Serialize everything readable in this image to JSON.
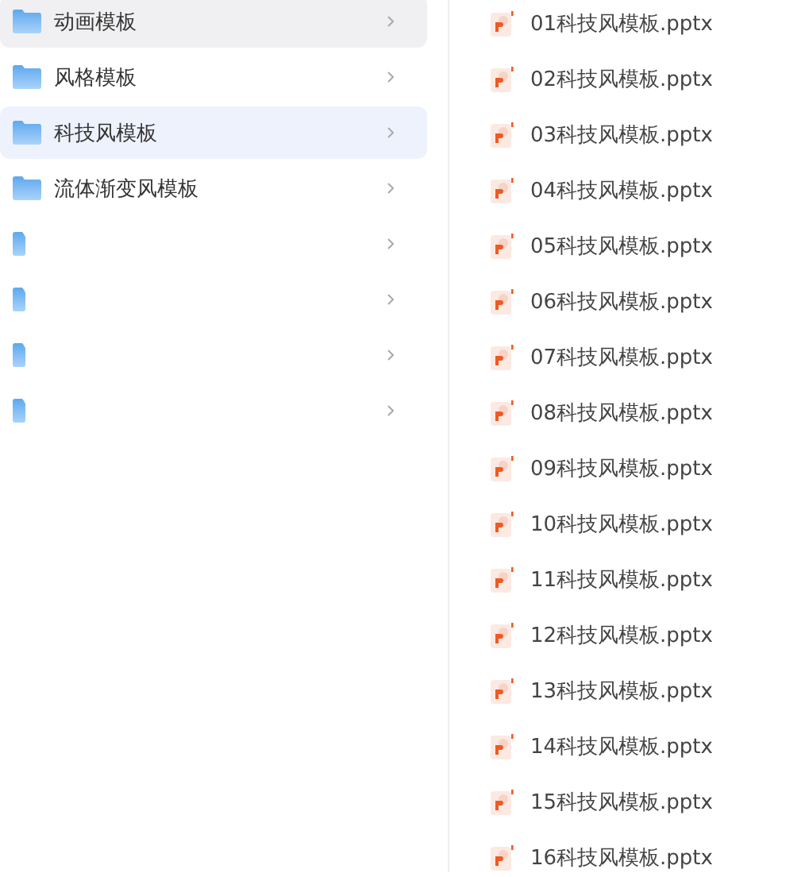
{
  "folders": [
    {
      "name": "动画模板",
      "selected": false,
      "hovered": true
    },
    {
      "name": "风格模板",
      "selected": false,
      "hovered": false
    },
    {
      "name": "科技风模板",
      "selected": true,
      "hovered": false
    },
    {
      "name": "流体渐变风模板",
      "selected": false,
      "hovered": false
    },
    {
      "selected": false,
      "hovered": false
    },
    {
      "selected": false,
      "hovered": false
    },
    {
      "selected": false,
      "hovered": false
    },
    {
      "selected": false,
      "hovered": false
    }
  ],
  "files": [
    {
      "name": "01科技风模板.pptx"
    },
    {
      "name": "02科技风模板.pptx"
    },
    {
      "name": "03科技风模板.pptx"
    },
    {
      "name": "04科技风模板.pptx"
    },
    {
      "name": "05科技风模板.pptx"
    },
    {
      "name": "06科技风模板.pptx"
    },
    {
      "name": "07科技风模板.pptx"
    },
    {
      "name": "08科技风模板.pptx"
    },
    {
      "name": "09科技风模板.pptx"
    },
    {
      "name": "10科技风模板.pptx"
    },
    {
      "name": "11科技风模板.pptx"
    },
    {
      "name": "12科技风模板.pptx"
    },
    {
      "name": "13科技风模板.pptx"
    },
    {
      "name": "14科技风模板.pptx"
    },
    {
      "name": "15科技风模板.pptx"
    },
    {
      "name": "16科技风模板.pptx"
    }
  ]
}
